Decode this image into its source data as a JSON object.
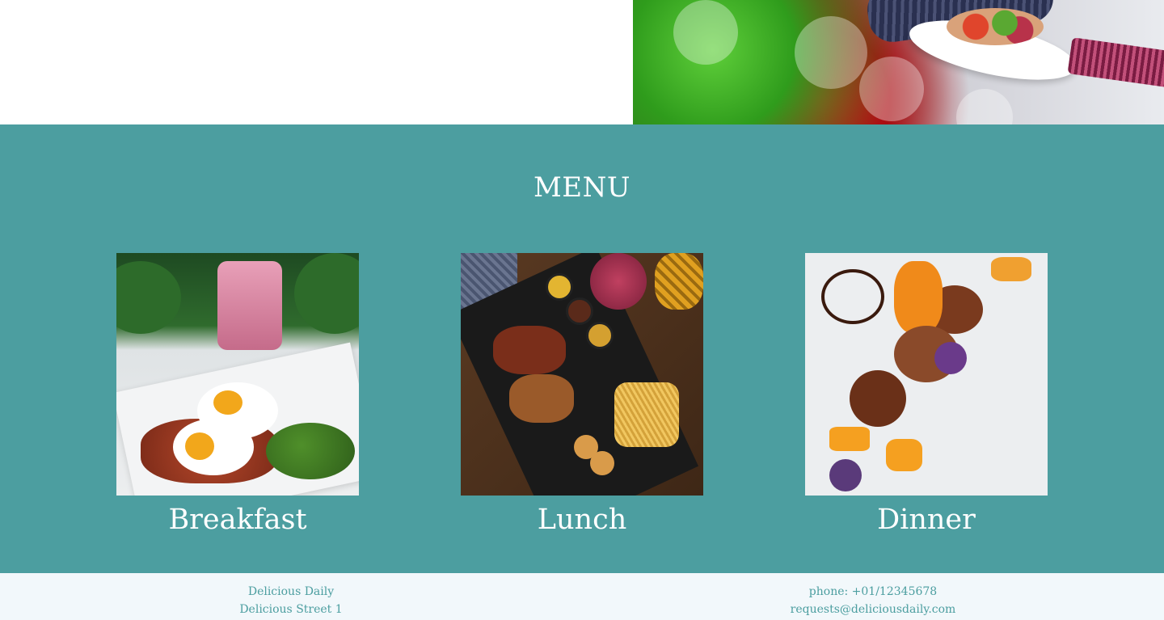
{
  "menu": {
    "title": "MENU",
    "items": [
      {
        "label": "Breakfast"
      },
      {
        "label": "Lunch"
      },
      {
        "label": "Dinner"
      }
    ]
  },
  "footer": {
    "name": "Delicious Daily",
    "street": "Delicious Street 1",
    "phone": "phone: +01/12345678",
    "email": "requests@deliciousdaily.com"
  },
  "colors": {
    "menu_background": "#4c9ea0",
    "footer_background": "#f2f8fb",
    "footer_text": "#4c9ea0"
  }
}
